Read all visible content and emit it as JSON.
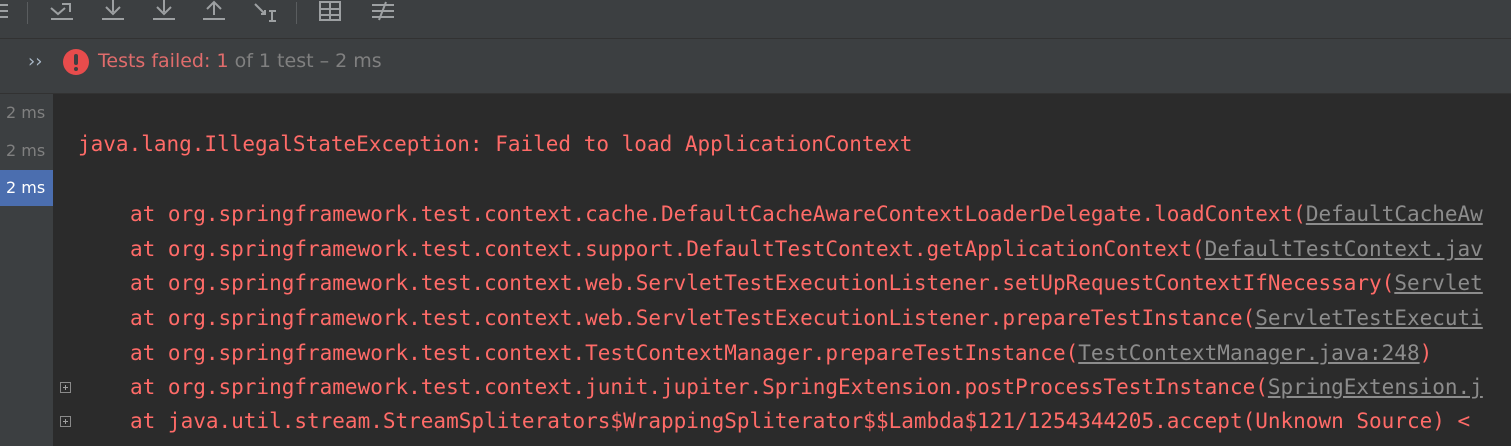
{
  "toolbar": {
    "icons": [
      "menu-icon",
      "import-results-icon",
      "download-icon",
      "download-icon",
      "upload-icon",
      "sort-icon",
      "table-icon",
      "settings-filter-icon"
    ]
  },
  "status": {
    "prefix": "Tests failed: ",
    "failed_count": "1",
    "suffix": " of 1 test – 2 ms"
  },
  "durations": [
    "2 ms",
    "2 ms",
    "2 ms"
  ],
  "console": {
    "exception": "java.lang.IllegalStateException: Failed to load ApplicationContext",
    "stack": [
      {
        "text": "at org.springframework.test.context.cache.DefaultCacheAwareContextLoaderDelegate.loadContext(",
        "link": "DefaultCacheAw",
        "tail": ""
      },
      {
        "text": "at org.springframework.test.context.support.DefaultTestContext.getApplicationContext(",
        "link": "DefaultTestContext.jav",
        "tail": ""
      },
      {
        "text": "at org.springframework.test.context.web.ServletTestExecutionListener.setUpRequestContextIfNecessary(",
        "link": "Servlet",
        "tail": ""
      },
      {
        "text": "at org.springframework.test.context.web.ServletTestExecutionListener.prepareTestInstance(",
        "link": "ServletTestExecuti",
        "tail": ""
      },
      {
        "text": "at org.springframework.test.context.TestContextManager.prepareTestInstance(",
        "link": "TestContextManager.java:248",
        "tail": ")"
      },
      {
        "text": "at org.springframework.test.context.junit.jupiter.SpringExtension.postProcessTestInstance(",
        "link": "SpringExtension.j",
        "tail": ""
      },
      {
        "text": "at java.util.stream.StreamSpliterators$WrappingSpliterator$$Lambda$121/1254344205.accept(Unknown Source) <",
        "link": "",
        "tail": ""
      }
    ]
  },
  "colors": {
    "error": "#ff6b68",
    "selection": "#4b6eaf",
    "panel": "#3c3f41",
    "console_bg": "#2b2b2b"
  }
}
